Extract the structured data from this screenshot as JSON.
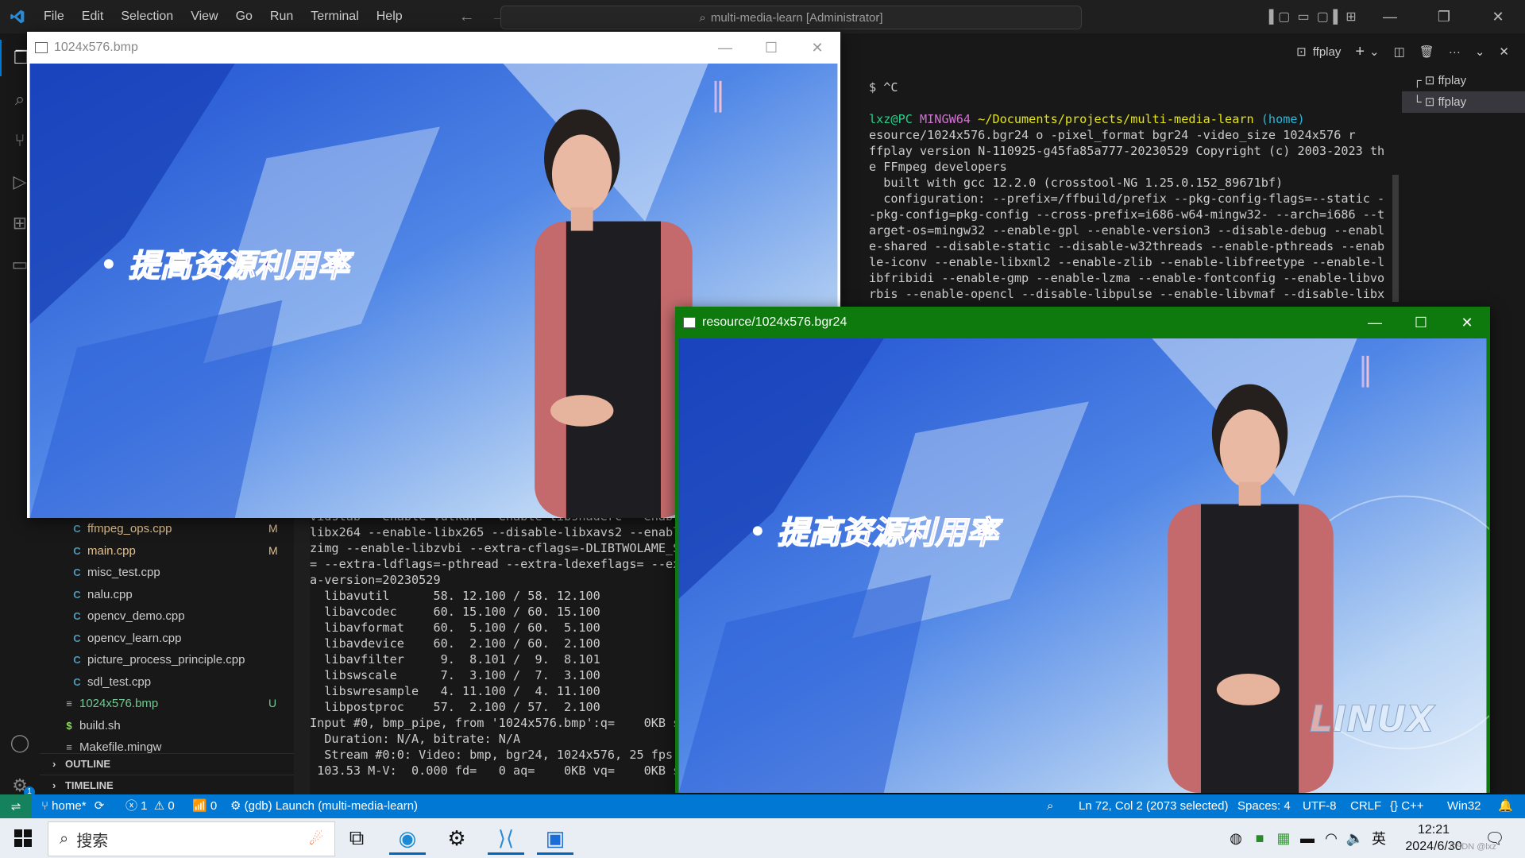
{
  "titlebar": {
    "menu": [
      "File",
      "Edit",
      "Selection",
      "View",
      "Go",
      "Run",
      "Terminal",
      "Help"
    ],
    "command_center": "multi-media-learn [Administrator]"
  },
  "sidebar": {
    "files": [
      {
        "name": "ffmpeg_ops.cpp",
        "icon": "C",
        "status": "M",
        "color": "#e2c08d"
      },
      {
        "name": "main.cpp",
        "icon": "C",
        "status": "M",
        "color": "#e2c08d"
      },
      {
        "name": "misc_test.cpp",
        "icon": "C",
        "status": "",
        "color": "#cccccc"
      },
      {
        "name": "nalu.cpp",
        "icon": "C",
        "status": "",
        "color": "#cccccc"
      },
      {
        "name": "opencv_demo.cpp",
        "icon": "C",
        "status": "",
        "color": "#cccccc"
      },
      {
        "name": "opencv_learn.cpp",
        "icon": "C",
        "status": "",
        "color": "#cccccc"
      },
      {
        "name": "picture_process_principle.cpp",
        "icon": "C",
        "status": "",
        "color": "#cccccc"
      },
      {
        "name": "sdl_test.cpp",
        "icon": "C",
        "status": "",
        "color": "#cccccc"
      },
      {
        "name": "1024x576.bmp",
        "icon": "≡",
        "status": "U",
        "color": "#73c991"
      },
      {
        "name": "build.sh",
        "icon": "$",
        "status": "",
        "color": "#cccccc"
      },
      {
        "name": "Makefile.mingw",
        "icon": "≡",
        "status": "",
        "color": "#cccccc"
      }
    ],
    "outline_label": "OUTLINE",
    "timeline_label": "TIMELINE"
  },
  "terminal": {
    "toolbar_label": "ffplay",
    "tabs": [
      "ffplay",
      "ffplay"
    ],
    "right_lines": [
      {
        "t": "$ ^C"
      },
      {
        "t": ""
      },
      {
        "seg": [
          [
            "lxz@PC ",
            "#23d18b"
          ],
          [
            "MINGW64 ",
            "#d670d6"
          ],
          [
            "~/Documents/projects/multi-media-learn",
            "#e5e510"
          ],
          [
            " (home)",
            "#29b8db"
          ]
        ]
      },
      {
        "t": "esource/1024x576.bgr24 o -pixel_format bgr24 -video_size 1024x576 r"
      },
      {
        "t": "ffplay version N-110925-g45fa85a777-20230529 Copyright (c) 2003-2023 th"
      },
      {
        "t": "e FFmpeg developers"
      },
      {
        "t": "  built with gcc 12.2.0 (crosstool-NG 1.25.0.152_89671bf)"
      },
      {
        "t": "  configuration: --prefix=/ffbuild/prefix --pkg-config-flags=--static -"
      },
      {
        "t": "-pkg-config=pkg-config --cross-prefix=i686-w64-mingw32- --arch=i686 --t"
      },
      {
        "t": "arget-os=mingw32 --enable-gpl --enable-version3 --disable-debug --enabl"
      },
      {
        "t": "e-shared --disable-static --disable-w32threads --enable-pthreads --enab"
      },
      {
        "t": "le-iconv --enable-libxml2 --enable-zlib --enable-libfreetype --enable-l"
      },
      {
        "t": "ibfribidi --enable-gmp --enable-lzma --enable-fontconfig --enable-libvo"
      },
      {
        "t": "rbis --enable-opencl --disable-libpulse --enable-libvmaf --disable-libx"
      }
    ],
    "left_lines": [
      "vidstab --enable-vulkan --enable-libshaderc --enabl",
      "libx264 --enable-libx265 --disable-libxavs2 --enabl",
      "zimg --enable-libzvbi --extra-cflags=-DLIBTWOLAME_S",
      "= --extra-ldflags=-pthread --extra-ldexeflags= --ex",
      "a-version=20230529",
      "  libavutil      58. 12.100 / 58. 12.100",
      "  libavcodec     60. 15.100 / 60. 15.100",
      "  libavformat    60.  5.100 / 60.  5.100",
      "  libavdevice    60.  2.100 / 60.  2.100",
      "  libavfilter     9.  8.101 /  9.  8.101",
      "  libswscale      7.  3.100 /  7.  3.100",
      "  libswresample   4. 11.100 /  4. 11.100",
      "  libpostproc    57.  2.100 / 57.  2.100",
      "Input #0, bmp_pipe, from '1024x576.bmp':q=    0KB s",
      "  Duration: N/A, bitrate: N/A",
      "  Stream #0:0: Video: bmp, bgr24, 1024x576, 25 fps,",
      " 103.53 M-V:  0.000 fd=   0 aq=    0KB vq=    0KB s"
    ]
  },
  "windows": {
    "bmp_title": "1024x576.bmp",
    "bgr_title": "resource/1024x576.bgr24",
    "banner_text": "提高资源利用率",
    "watermark": "LINUX"
  },
  "statusbar": {
    "branch": "home*",
    "errors": "1",
    "warnings": "0",
    "ports": "0",
    "debug": "(gdb) Launch (multi-media-learn)",
    "position": "Ln 72, Col 2 (2073 selected)",
    "spaces": "Spaces: 4",
    "encoding": "UTF-8",
    "eol": "CRLF",
    "language": "C++",
    "platform": "Win32",
    "notifications_badge": "1"
  },
  "taskbar": {
    "search_placeholder": "搜索",
    "ime": "英",
    "time": "12:21",
    "date": "2024/6/30",
    "watermark": "CSDN @lxz"
  },
  "colors": {
    "statusbar": "#0078d4",
    "bgr_titlebar": "#0e7a0d",
    "accent": "#0078d4"
  }
}
